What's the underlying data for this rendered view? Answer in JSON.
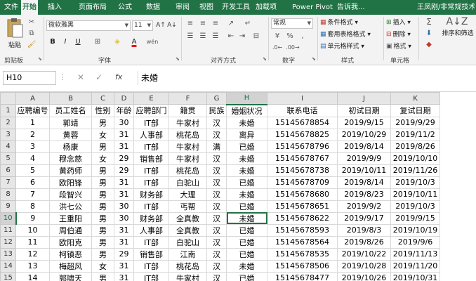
{
  "tabs": [
    "文件",
    "开始",
    "插入",
    "页面布局",
    "公式",
    "数据",
    "审阅",
    "视图",
    "开发工具",
    "加载项",
    "Power Pivot",
    "告诉我..."
  ],
  "user": "王凤刚/非常规技术",
  "ribbon": {
    "paste": "粘贴",
    "clipboard_label": "剪贴板",
    "font_name": "微软雅黑",
    "font_size": "11",
    "font_label": "字体",
    "align_label": "对齐方式",
    "number_format": "常规",
    "number_label": "数字",
    "cond_format": "条件格式",
    "table_format": "套用表格格式",
    "cell_style": "单元格样式",
    "styles_label": "样式",
    "insert": "插入",
    "delete": "删除",
    "format": "格式",
    "cells_label": "单元格",
    "sort_filter": "排序和筛选",
    "bold": "B",
    "italic": "I",
    "underline": "U",
    "font_color_glyph": "A"
  },
  "formula_bar": {
    "name_box": "H10",
    "cancel": "✕",
    "enter": "✓",
    "fx": "fx",
    "value": "未婚"
  },
  "columns": [
    "A",
    "B",
    "C",
    "D",
    "E",
    "F",
    "G",
    "H",
    "I",
    "J",
    "K"
  ],
  "rows": [
    [
      "1",
      "应聘编号",
      "员工姓名",
      "性别",
      "年龄",
      "应聘部门",
      "籍贯",
      "民族",
      "婚姻状况",
      "联系电话",
      "初试日期",
      "复试日期"
    ],
    [
      "2",
      "1",
      "郭靖",
      "男",
      "30",
      "IT部",
      "牛家村",
      "汉",
      "未婚",
      "15145678854",
      "2019/9/15",
      "2019/9/29"
    ],
    [
      "3",
      "2",
      "黄蓉",
      "女",
      "31",
      "人事部",
      "桃花岛",
      "汉",
      "离异",
      "15145678825",
      "2019/10/29",
      "2019/11/2"
    ],
    [
      "4",
      "3",
      "杨康",
      "男",
      "31",
      "IT部",
      "牛家村",
      "满",
      "已婚",
      "15145678796",
      "2019/8/14",
      "2019/8/26"
    ],
    [
      "5",
      "4",
      "穆念慈",
      "女",
      "29",
      "销售部",
      "牛家村",
      "汉",
      "未婚",
      "15145678767",
      "2019/9/9",
      "2019/10/10"
    ],
    [
      "6",
      "5",
      "黄药师",
      "男",
      "29",
      "IT部",
      "桃花岛",
      "汉",
      "未婚",
      "15145678738",
      "2019/10/11",
      "2019/11/26"
    ],
    [
      "7",
      "6",
      "欧阳锋",
      "男",
      "31",
      "IT部",
      "白驼山",
      "汉",
      "已婚",
      "15145678709",
      "2019/8/14",
      "2019/10/3"
    ],
    [
      "8",
      "7",
      "段智兴",
      "男",
      "31",
      "财务部",
      "大理",
      "汉",
      "未婚",
      "15145678680",
      "2019/8/23",
      "2019/10/11"
    ],
    [
      "9",
      "8",
      "洪七公",
      "男",
      "30",
      "IT部",
      "丐帮",
      "汉",
      "已婚",
      "15145678651",
      "2019/9/2",
      "2019/10/3"
    ],
    [
      "10",
      "9",
      "王重阳",
      "男",
      "30",
      "财务部",
      "全真教",
      "汉",
      "未婚",
      "15145678622",
      "2019/9/17",
      "2019/9/15"
    ],
    [
      "11",
      "10",
      "周伯通",
      "男",
      "31",
      "人事部",
      "全真教",
      "汉",
      "已婚",
      "15145678593",
      "2019/8/3",
      "2019/10/19"
    ],
    [
      "12",
      "11",
      "欧阳克",
      "男",
      "31",
      "IT部",
      "白驼山",
      "汉",
      "已婚",
      "15145678564",
      "2019/8/26",
      "2019/9/6"
    ],
    [
      "13",
      "12",
      "柯镇恶",
      "男",
      "29",
      "销售部",
      "江南",
      "汉",
      "已婚",
      "15145678535",
      "2019/10/22",
      "2019/11/13"
    ],
    [
      "14",
      "13",
      "梅超风",
      "女",
      "31",
      "IT部",
      "桃花岛",
      "汉",
      "未婚",
      "15145678506",
      "2019/10/28",
      "2019/11/20"
    ],
    [
      "15",
      "14",
      "郭啸天",
      "男",
      "31",
      "IT部",
      "牛家村",
      "汉",
      "已婚",
      "15145678477",
      "2019/10/26",
      "2019/10/31"
    ]
  ],
  "selected": {
    "row": "10",
    "col": "H"
  },
  "colors": {
    "accent": "#217346"
  }
}
